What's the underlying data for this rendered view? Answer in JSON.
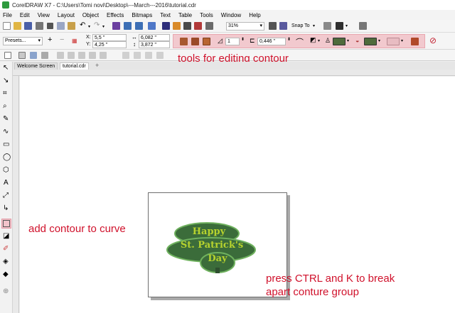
{
  "window": {
    "title": "CorelDRAW X7 - C:\\Users\\Tomi novi\\Desktop\\---March---2016\\tutorial.cdr"
  },
  "menu": [
    "File",
    "Edit",
    "View",
    "Layout",
    "Object",
    "Effects",
    "Bitmaps",
    "Text",
    "Table",
    "Tools",
    "Window",
    "Help"
  ],
  "standard_toolbar": {
    "zoom_value": "31%",
    "snap_label": "Snap To"
  },
  "property_bar": {
    "presets_value": "Presets...",
    "x_label": "X:",
    "x_value": "5,5 \"",
    "y_label": "Y:",
    "y_value": "4,25 \"",
    "width_value": "6,082 \"",
    "height_value": "3,872 \"",
    "steps_value": "1",
    "offset_value": "0,446 \""
  },
  "tabs": [
    "Welcome Screen",
    "tutorial.cdr"
  ],
  "canvas_text": [
    "Happy",
    "St. Patrick's",
    "Day"
  ],
  "annotations": {
    "contour_tools": "tools for editing contour",
    "add_contour": "add contour to curve",
    "break_apart": "press CTRL and K to break apart conture group"
  },
  "colors": {
    "highlight": "#f2c9ce",
    "annotation": "#d0112b",
    "contour_fill": "#3b6c3a",
    "contour_outline": "#5a9b4c",
    "text": "#b6d22e"
  }
}
